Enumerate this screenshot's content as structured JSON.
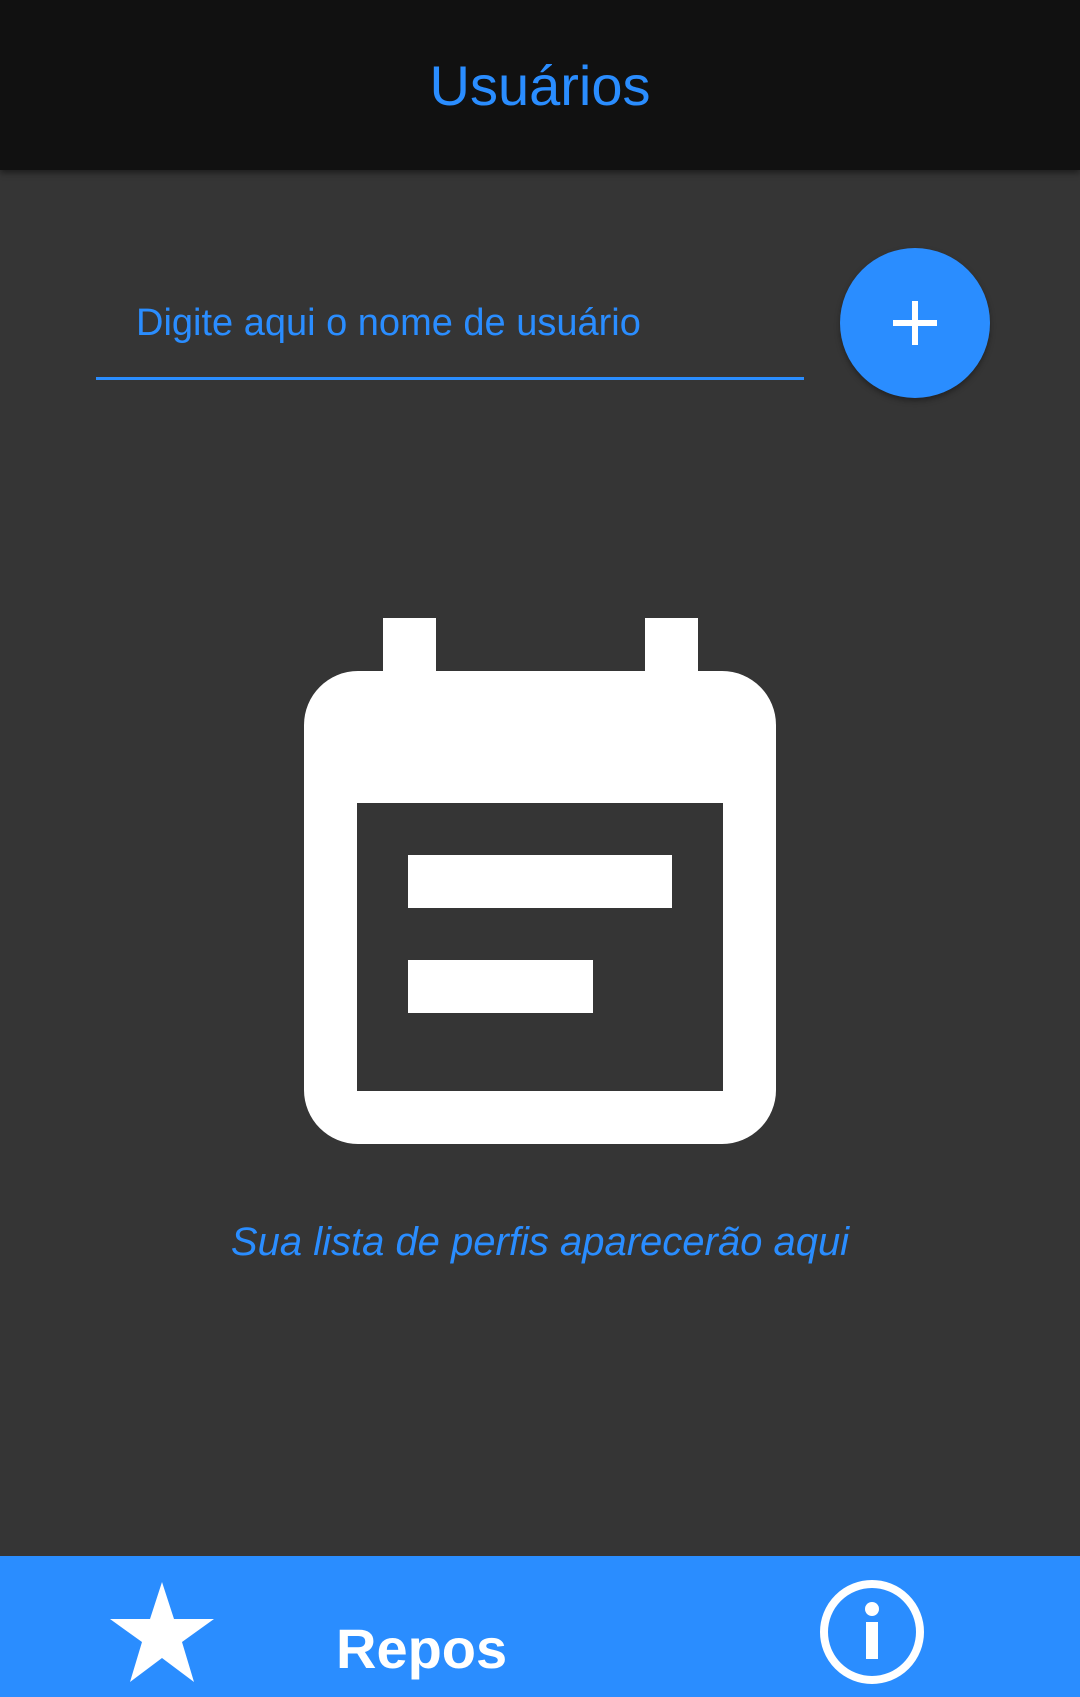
{
  "header": {
    "title": "Usuários"
  },
  "search": {
    "placeholder": "Digite aqui o nome de usuário",
    "value": ""
  },
  "add_button": {
    "icon": "plus-icon"
  },
  "empty_state": {
    "icon": "calendar-text-icon",
    "message": "Sua lista de perfis aparecerão aqui"
  },
  "bottom_nav": {
    "items": [
      {
        "icon": "star-icon",
        "label": "Repos"
      },
      {
        "icon": "info-icon",
        "label": ""
      }
    ]
  },
  "colors": {
    "accent": "#2a8dff",
    "header_bg": "#111111",
    "content_bg": "#353535",
    "icon_fill": "#ffffff"
  }
}
